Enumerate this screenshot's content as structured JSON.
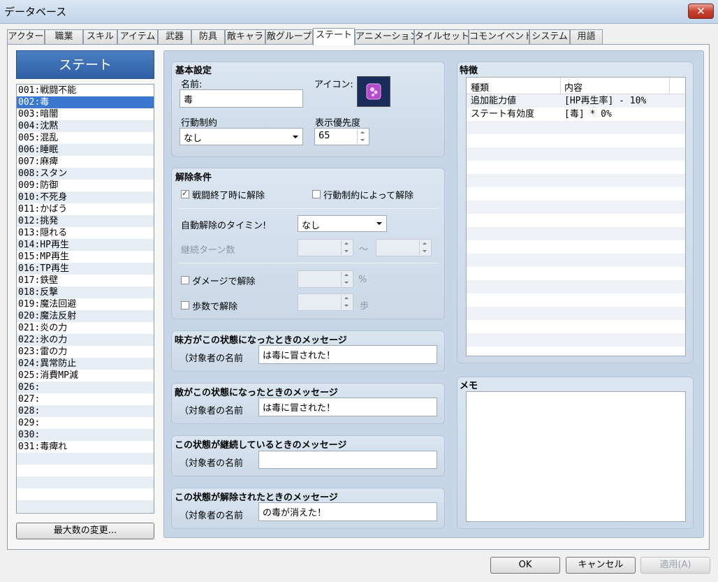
{
  "window": {
    "title": "データベース",
    "close_label": "✕"
  },
  "tabs": [
    "アクター",
    "職業",
    "スキル",
    "アイテム",
    "武器",
    "防具",
    "敵キャラ",
    "敵グループ",
    "ステート",
    "アニメーション",
    "タイルセット",
    "コモンイベント",
    "システム",
    "用語"
  ],
  "active_tab": "ステート",
  "list": {
    "header": "ステート",
    "items": [
      "001:戦闘不能",
      "002:毒",
      "003:暗闇",
      "004:沈黙",
      "005:混乱",
      "006:睡眠",
      "007:麻痺",
      "008:スタン",
      "009:防御",
      "010:不死身",
      "011:かばう",
      "012:挑発",
      "013:隠れる",
      "014:HP再生",
      "015:MP再生",
      "016:TP再生",
      "017:鉄壁",
      "018:反撃",
      "019:魔法回避",
      "020:魔法反射",
      "021:炎の力",
      "022:氷の力",
      "023:雷の力",
      "024:異常防止",
      "025:消費MP減",
      "026:",
      "027:",
      "028:",
      "029:",
      "030:",
      "031:毒痺れ"
    ],
    "selected_index": 1,
    "max_button": "最大数の変更..."
  },
  "basic": {
    "title": "基本設定",
    "name_label": "名前:",
    "name_value": "毒",
    "icon_label": "アイコン:",
    "restriction_label": "行動制約",
    "restriction_value": "なし",
    "priority_label": "表示優先度",
    "priority_value": "65"
  },
  "removal": {
    "title": "解除条件",
    "battle_end_label": "戦闘終了時に解除",
    "battle_end_checked": true,
    "restriction_label": "行動制約によって解除",
    "restriction_checked": false,
    "auto_timing_label": "自動解除のタイミン!",
    "auto_timing_value": "なし",
    "turns_label": "継続ターン数",
    "tilde": "～",
    "damage_label": "ダメージで解除",
    "damage_unit": "%",
    "steps_label": "歩数で解除",
    "steps_unit": "歩"
  },
  "messages": [
    {
      "title": "味方がこの状態になったときのメッセージ",
      "prefix": "（対象者の名前",
      "value": "は毒に冒された！"
    },
    {
      "title": "敵がこの状態になったときのメッセージ",
      "prefix": "（対象者の名前",
      "value": "は毒に冒された！"
    },
    {
      "title": "この状態が継続しているときのメッセージ",
      "prefix": "（対象者の名前",
      "value": ""
    },
    {
      "title": "この状態が解除されたときのメッセージ",
      "prefix": "（対象者の名前",
      "value": "の毒が消えた！"
    }
  ],
  "traits": {
    "title": "特徴",
    "col_type": "種類",
    "col_content": "内容",
    "rows": [
      {
        "type": "追加能力値",
        "content": "[HP再生率] - 10%"
      },
      {
        "type": "ステート有効度",
        "content": "[毒] * 0%"
      }
    ]
  },
  "memo": {
    "title": "メモ",
    "value": ""
  },
  "footer": {
    "ok": "OK",
    "cancel": "キャンセル",
    "apply": "適用(A)"
  },
  "colors": {
    "accent": "#3a78cf",
    "panel": "#c7d6e6",
    "header": "#2f5fa6"
  }
}
